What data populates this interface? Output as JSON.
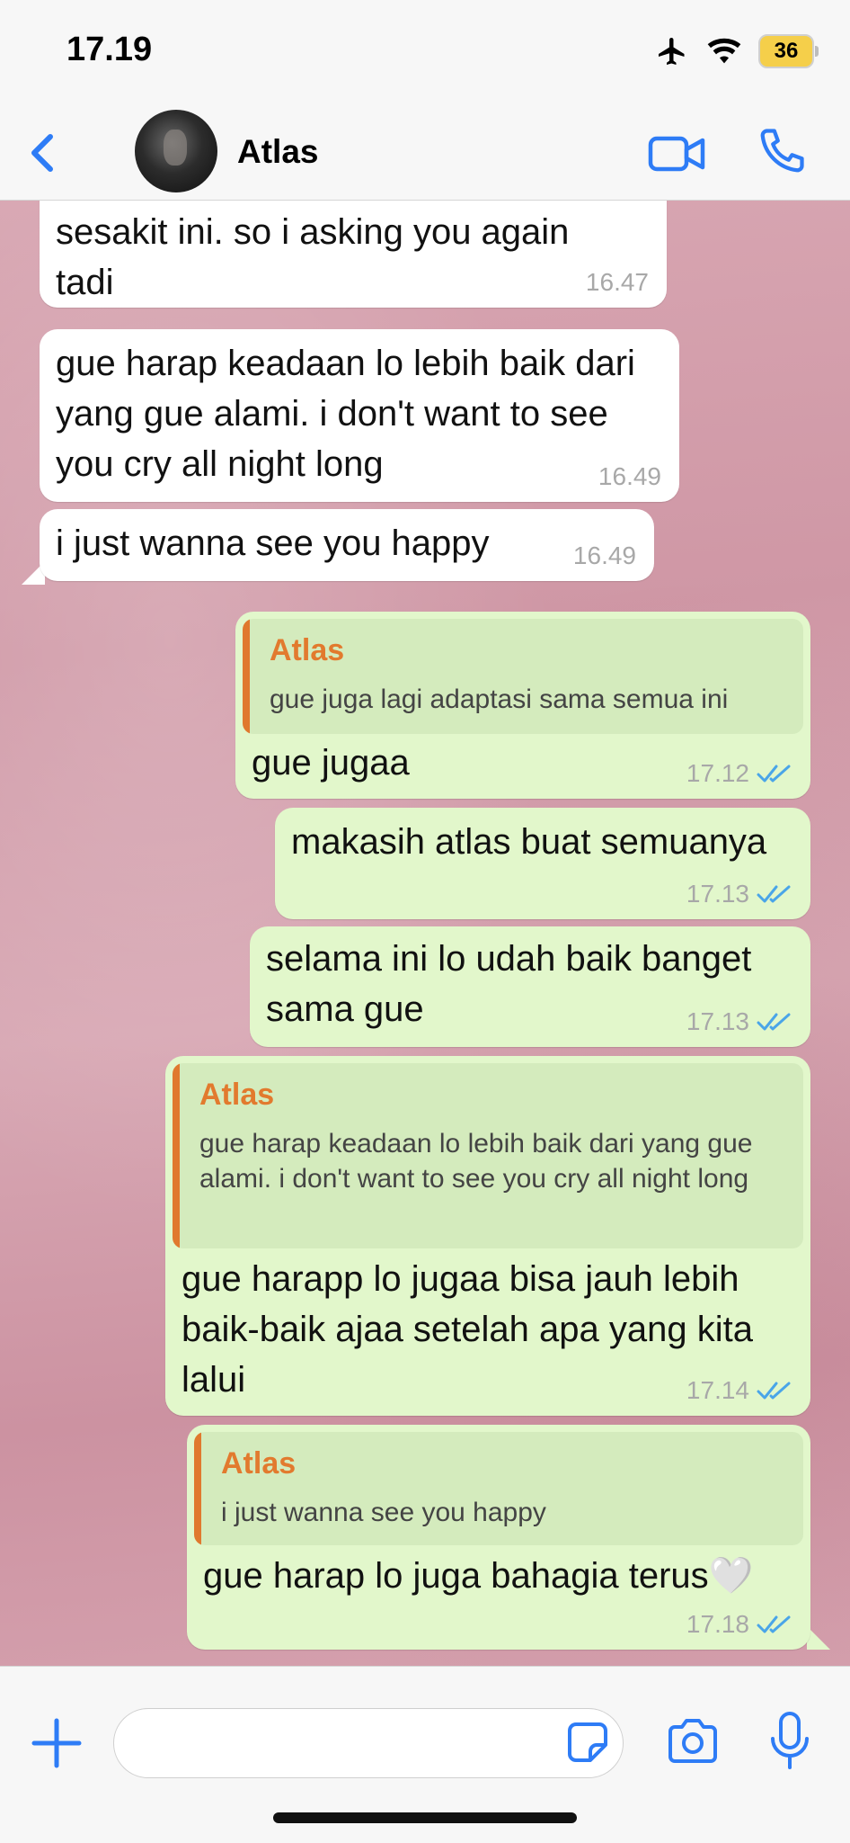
{
  "status": {
    "time": "17.19",
    "battery": "36"
  },
  "header": {
    "contact_name": "Atlas"
  },
  "messages": [
    {
      "dir": "in",
      "text": "sesakit ini. so i asking you again tadi",
      "time": "16.47"
    },
    {
      "dir": "in",
      "text": "gue harap keadaan lo lebih baik dari yang gue alami. i don't want to see you cry all night long",
      "time": "16.49"
    },
    {
      "dir": "in",
      "text": "i just wanna see you happy",
      "time": "16.49"
    },
    {
      "dir": "out",
      "quote_name": "Atlas",
      "quote_text": "gue juga lagi adaptasi sama semua ini",
      "text": "gue jugaa",
      "time": "17.12"
    },
    {
      "dir": "out",
      "text": "makasih atlas buat semuanya",
      "time": "17.13"
    },
    {
      "dir": "out",
      "text": "selama ini lo udah baik banget sama gue",
      "time": "17.13"
    },
    {
      "dir": "out",
      "quote_name": "Atlas",
      "quote_text": "gue harap keadaan lo lebih baik dari yang gue alami. i don't want to see you cry all night long",
      "text": "gue harapp lo jugaa bisa jauh lebih baik-baik ajaa setelah apa yang kita lalui",
      "time": "17.14"
    },
    {
      "dir": "out",
      "quote_name": "Atlas",
      "quote_text": "i just wanna see you happy",
      "text": "gue harap lo juga bahagia terus🤍",
      "time": "17.18"
    }
  ],
  "colors": {
    "accent": "#2e7cf6",
    "quote_name": "#e27a2e",
    "outgoing_bubble": "#e2f7cb",
    "read_ticks": "#4aa5e8"
  }
}
